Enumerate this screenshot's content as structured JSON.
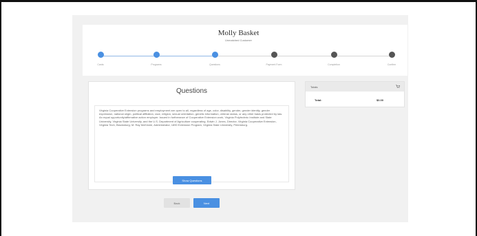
{
  "header": {
    "title": "Molly Basket",
    "subtitle": "Unmatched Customer"
  },
  "steps": [
    {
      "label": "Cards",
      "status": "complete"
    },
    {
      "label": "Programs",
      "status": "complete"
    },
    {
      "label": "Questions",
      "status": "complete"
    },
    {
      "label": "Payment Form",
      "status": "pending"
    },
    {
      "label": "Completion",
      "status": "pending"
    },
    {
      "label": "Confirm",
      "status": "pending"
    }
  ],
  "questions": {
    "title": "Questions",
    "body": "Virginia Cooperative Extension programs and employment are open to all, regardless of age, color, disability, gender, gender identity, gender expression, national origin, political affiliation, race, religion, sexual orientation, genetic information, veteran status, or any other basis protected by law. An equal opportunity/affirmative action employer. Issued in furtherance of Cooperative Extension work, Virginia Polytechnic Institute and State University, Virginia State University, and the U.S. Department of Agriculture cooperating. Edwin J. Jones, Director, Virginia Cooperative Extension, Virginia Tech, Blacksburg; M. Ray McKinnie, Administrator, 1890 Extension Program, Virginia State University, Petersburg.",
    "show_button": "Show Questions"
  },
  "summary": {
    "header": "Totals",
    "total_label": "Total:",
    "total_value": "$0.00"
  },
  "nav": {
    "back": "Back",
    "next": "Next"
  },
  "colors": {
    "accent": "#4a90e2",
    "pending": "#555555"
  }
}
